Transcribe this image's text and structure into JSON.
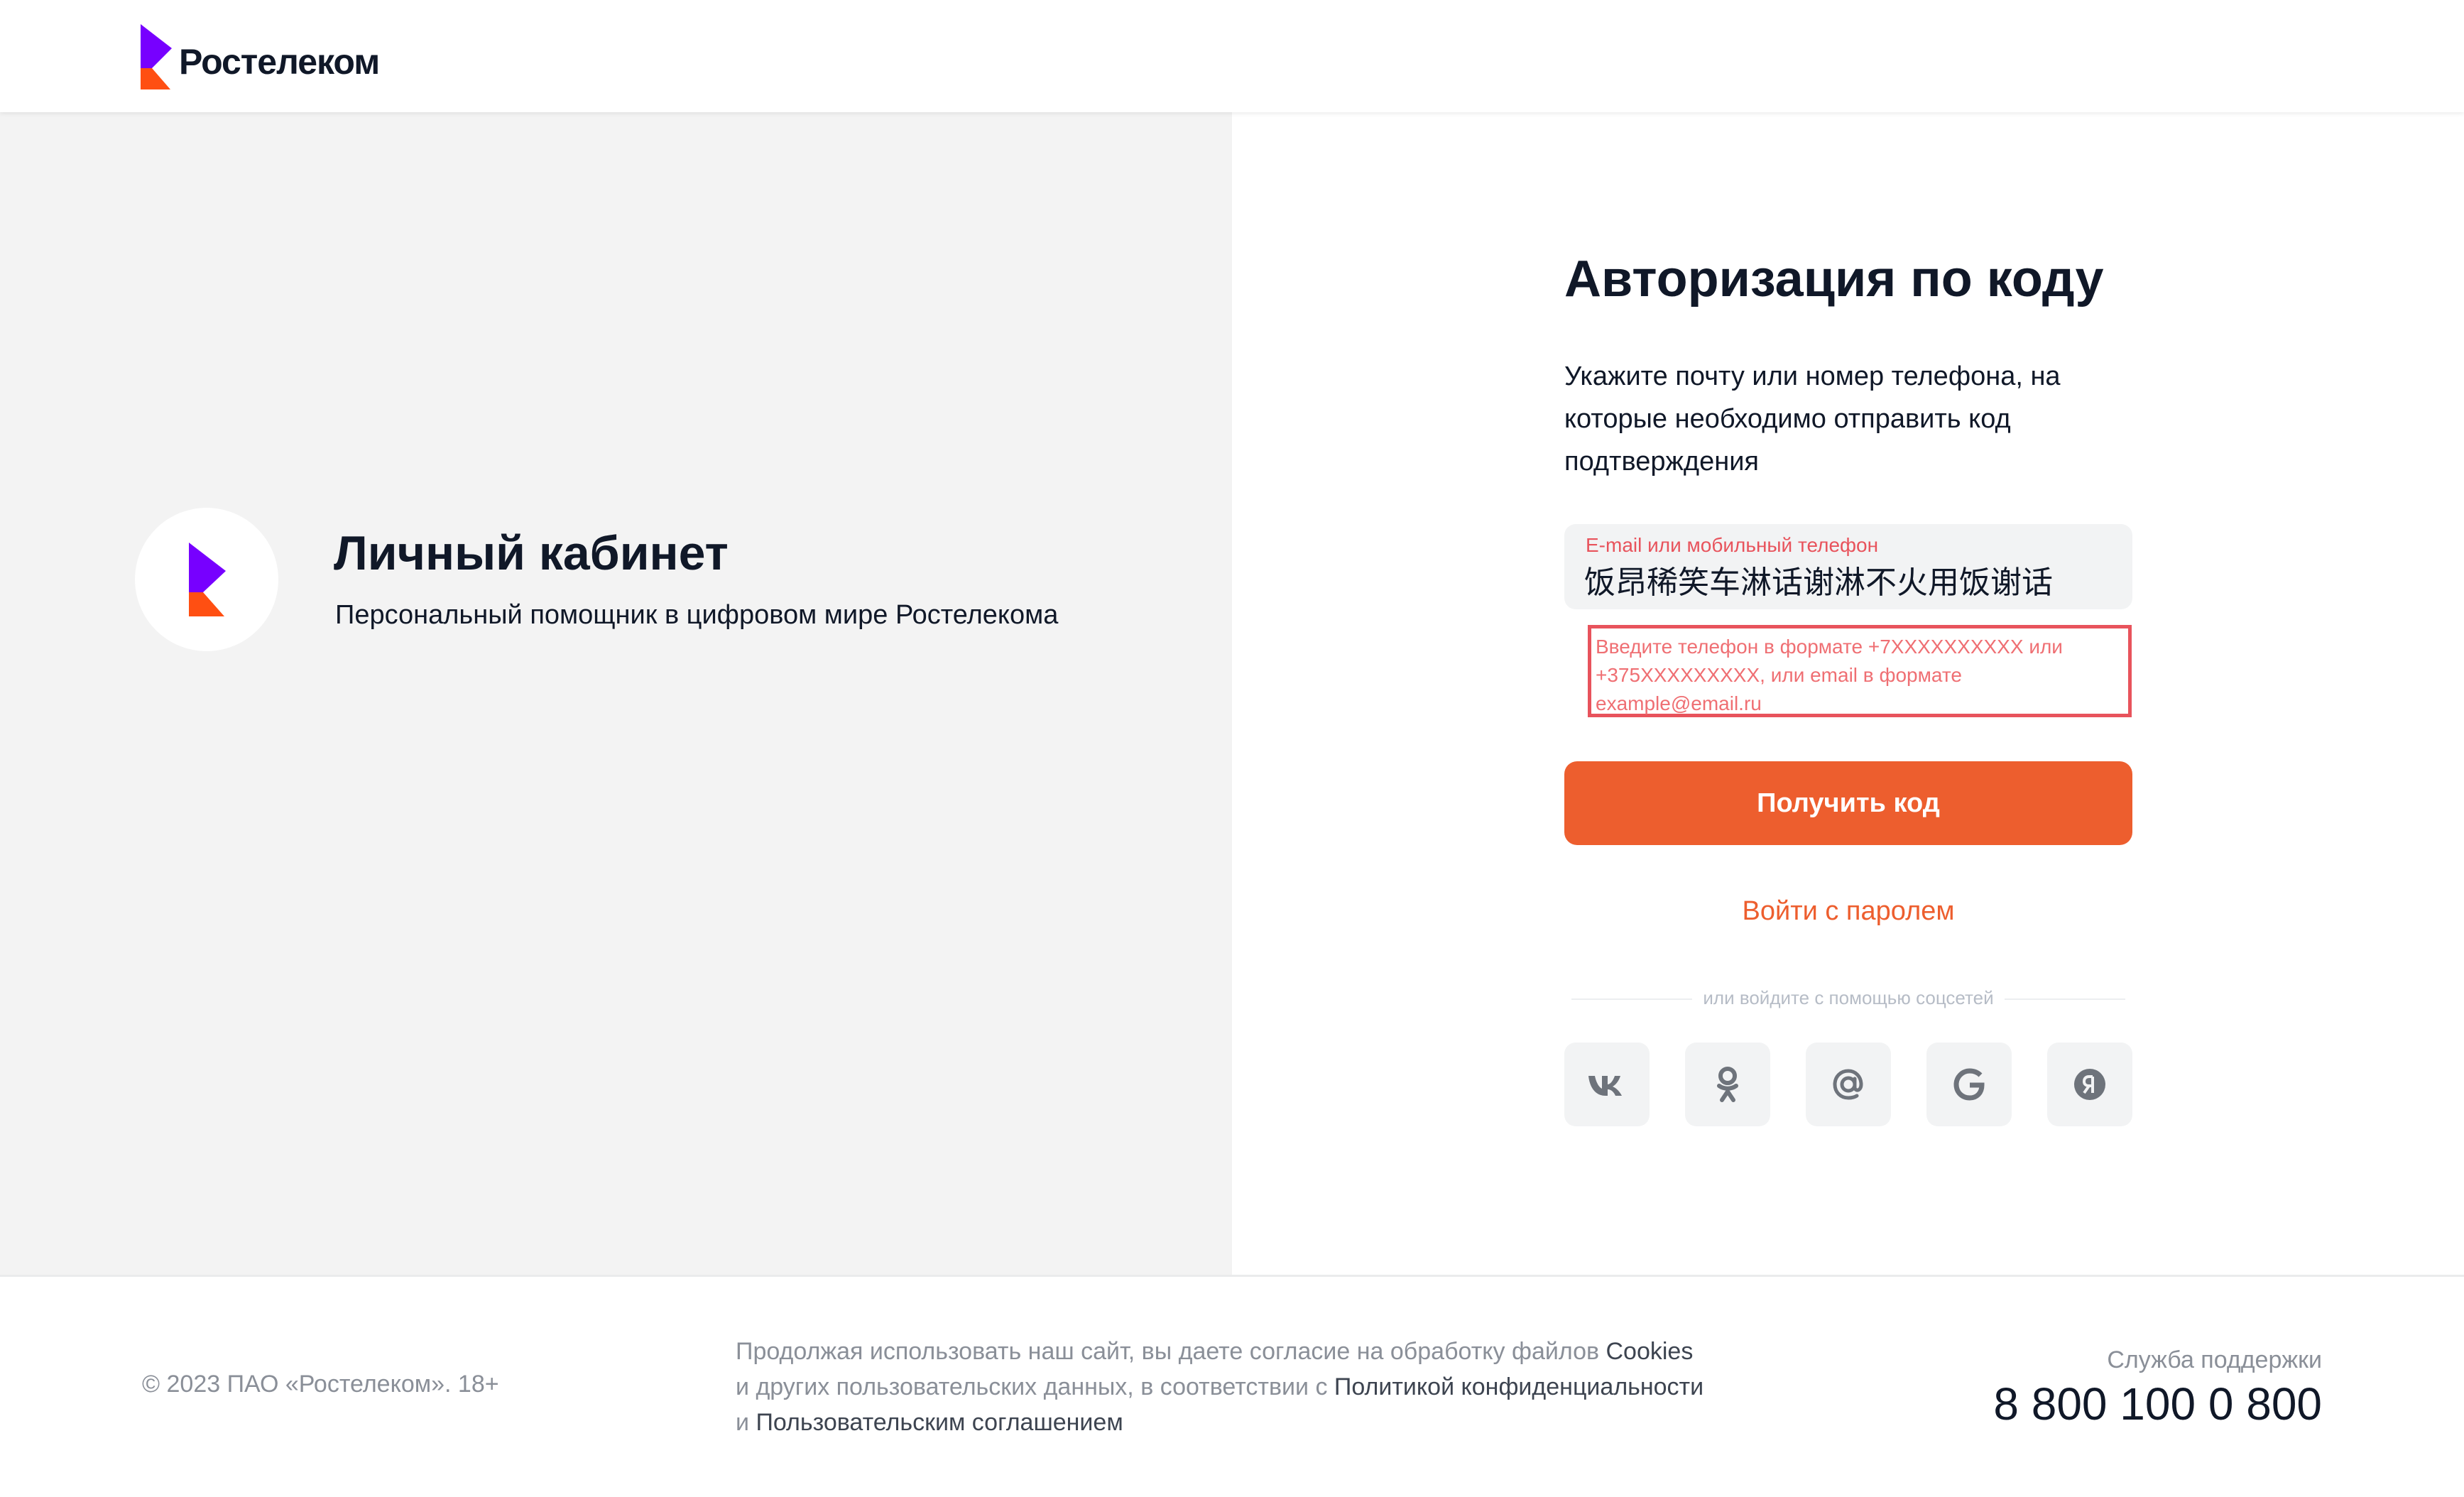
{
  "header": {
    "brand_name": "Ростелеком",
    "logo_icon": "rostelecom-logo-icon"
  },
  "promo": {
    "title": "Личный кабинет",
    "subtitle": "Персональный помощник в цифровом мире Ростелекома"
  },
  "auth": {
    "title": "Авторизация по коду",
    "description": "Укажите почту или номер телефона, на которые необходимо отправить код подтверждения",
    "field_label": "E-mail или мобильный телефон",
    "field_value": "饭昂稀笑车淋话谢淋不火用饭谢话",
    "error_text": "Введите телефон в формате +7XXXXXXXXXX или +375XXXXXXXXX, или email в формате example@email.ru",
    "submit_label": "Получить код",
    "password_link": "Войти с паролем",
    "social_divider": "или войдите с помощью соцсетей",
    "socials": [
      "vk-icon",
      "ok-icon",
      "mail-ru-icon",
      "google-icon",
      "yandex-icon"
    ]
  },
  "footer": {
    "copyright": "© 2023 ПАО «Ростелеком». 18+",
    "legal_part1": "Продолжая использовать наш сайт, вы даете согласие на обработку файлов ",
    "legal_cookies": "Cookies",
    "legal_part2": " и других пользовательских данных, в соответствии с ",
    "legal_privacy": "Политикой конфиденциальности",
    "legal_part3": " и ",
    "legal_terms": "Пользовательским соглашением",
    "support_label": "Служба поддержки",
    "support_phone": "8 800 100 0 800"
  },
  "colors": {
    "accent": "#ed5e2e",
    "brand_purple": "#7700ff",
    "error": "#e8535c",
    "panel_bg": "#f3f3f3"
  }
}
